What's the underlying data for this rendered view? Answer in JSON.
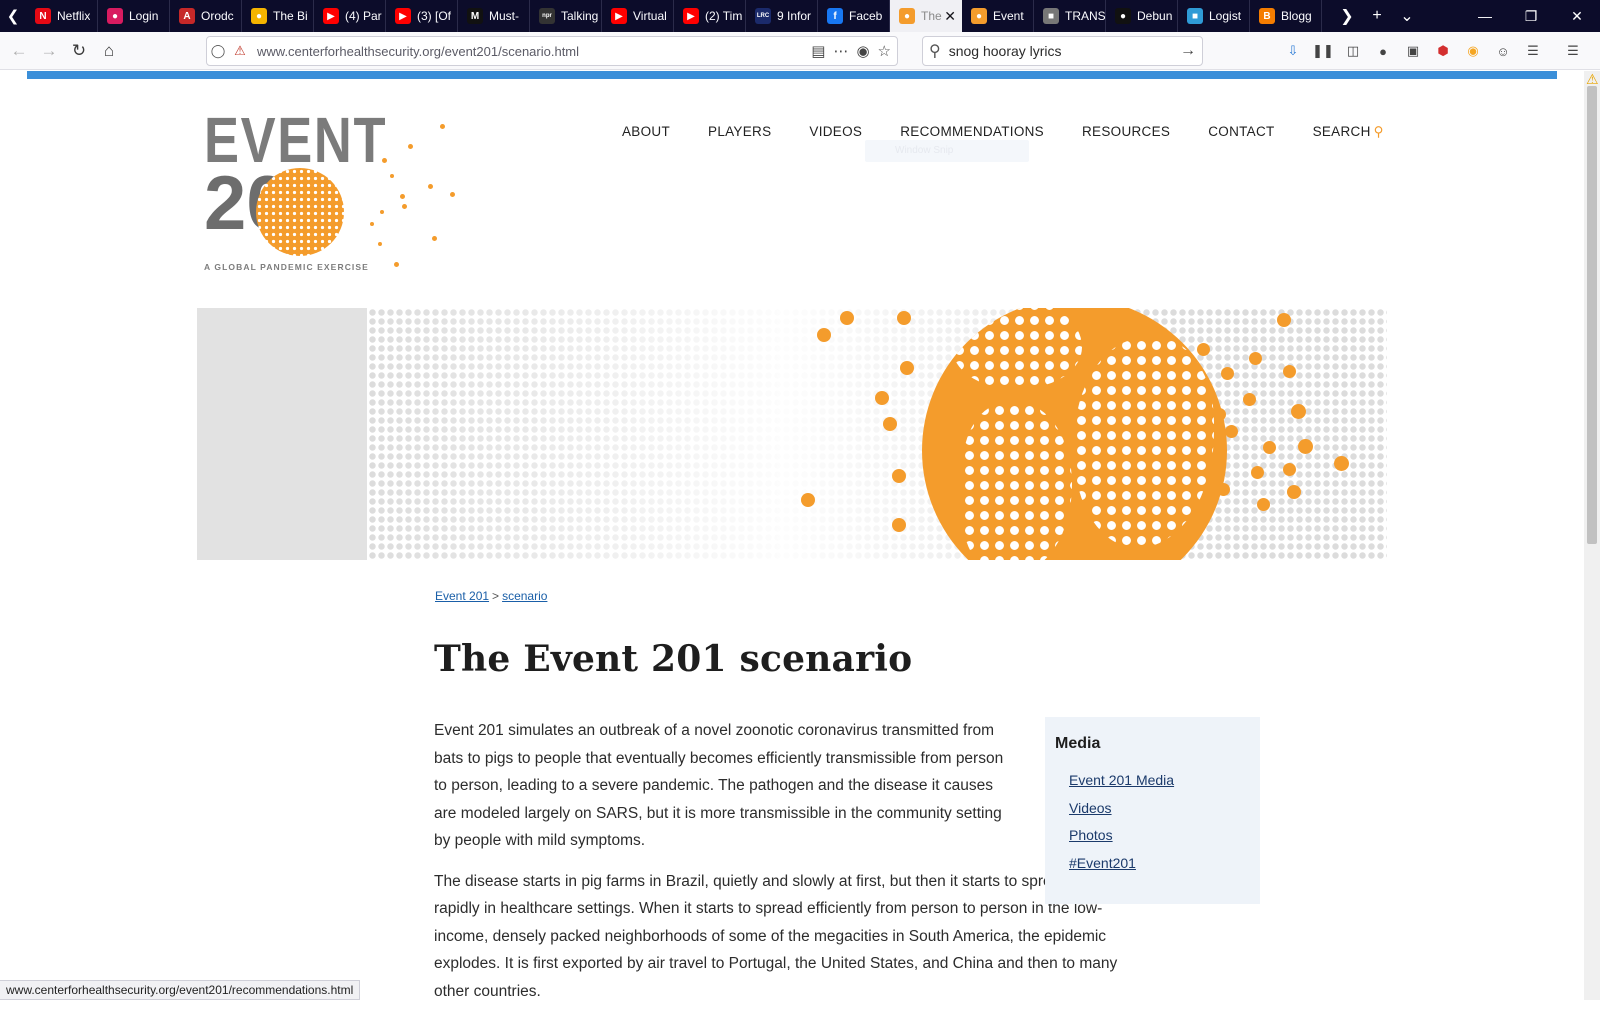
{
  "browser": {
    "tabs": [
      {
        "title": "Netflix",
        "icon": "netflix-icon",
        "color": "#e50914",
        "glyph": "N"
      },
      {
        "title": "Login",
        "icon": "login-icon",
        "color": "#d81b60",
        "glyph": "●"
      },
      {
        "title": "Orodc",
        "icon": "orodc-icon",
        "color": "#c62828",
        "glyph": "A"
      },
      {
        "title": "The Bi",
        "icon": "the-b-icon",
        "color": "#f5b400",
        "glyph": "●"
      },
      {
        "title": "(4) Par",
        "icon": "youtube-icon",
        "color": "#ff0000",
        "glyph": "▶"
      },
      {
        "title": "(3) [Of",
        "icon": "youtube-icon",
        "color": "#ff0000",
        "glyph": "▶"
      },
      {
        "title": "Must-",
        "icon": "medium-icon",
        "color": "#111111",
        "glyph": "M"
      },
      {
        "title": "Talking",
        "icon": "npr-icon",
        "color": "#333333",
        "glyph": "npr"
      },
      {
        "title": "Virtual",
        "icon": "youtube-icon",
        "color": "#ff0000",
        "glyph": "▶"
      },
      {
        "title": "(2) Tim",
        "icon": "youtube-icon",
        "color": "#ff0000",
        "glyph": "▶"
      },
      {
        "title": "9 Infor",
        "icon": "lrc-icon",
        "color": "#1b2a6b",
        "glyph": "LRC"
      },
      {
        "title": "Faceb",
        "icon": "facebook-icon",
        "color": "#1877f2",
        "glyph": "f"
      },
      {
        "title": "The",
        "icon": "event201-icon",
        "color": "#f49c2c",
        "glyph": "●"
      },
      {
        "title": "Event",
        "icon": "event201-icon",
        "color": "#f49c2c",
        "glyph": "●"
      },
      {
        "title": "TRANS",
        "icon": "trans-icon",
        "color": "#777777",
        "glyph": "■"
      },
      {
        "title": "Debun",
        "icon": "debunk-icon",
        "color": "#111111",
        "glyph": "●"
      },
      {
        "title": "Logist",
        "icon": "logist-icon",
        "color": "#2f9bd6",
        "glyph": "■"
      },
      {
        "title": "Blogg",
        "icon": "blogger-icon",
        "color": "#f57d00",
        "glyph": "B"
      }
    ],
    "active_tab_index": 12,
    "url": "www.centerforhealthsecurity.org/event201/scenario.html",
    "search_query": "snog hooray lyrics",
    "status_url": "www.centerforhealthsecurity.org/event201/recommendations.html",
    "accent": "#3b8fd9"
  },
  "logo": {
    "word": "EVENT",
    "number": "201",
    "tagline": "A GLOBAL PANDEMIC EXERCISE",
    "orange": "#f49c2c",
    "gray": "#7b7b7b"
  },
  "nav": {
    "items": [
      "ABOUT",
      "PLAYERS",
      "VIDEOS",
      "RECOMMENDATIONS",
      "RESOURCES",
      "CONTACT"
    ],
    "search_label": "SEARCH",
    "tooltip": "Window Snip"
  },
  "breadcrumb": {
    "home": "Event 201",
    "separator": ">",
    "current": "scenario"
  },
  "page": {
    "title": "The Event 201 scenario",
    "paragraphs": [
      "Event 201 simulates an outbreak of a novel zoonotic coronavirus transmitted from bats to pigs to people that eventually becomes efficiently transmissible from person to person, leading to a severe pandemic. The pathogen and the disease it causes are modeled largely on SARS, but it is more transmissible in the community setting by people with mild symptoms.",
      "The disease starts in pig farms in Brazil, quietly and slowly at first, but then it starts to spread more rapidly in healthcare settings. When it starts to spread efficiently from person to person in the low-income, densely packed neighborhoods of some of the megacities in South America, the epidemic explodes. It is first exported by air travel to Portugal, the United States, and China and then to many other countries."
    ]
  },
  "media": {
    "heading": "Media",
    "links": [
      "Event 201 Media",
      "Videos",
      "Photos",
      "#Event201"
    ]
  }
}
